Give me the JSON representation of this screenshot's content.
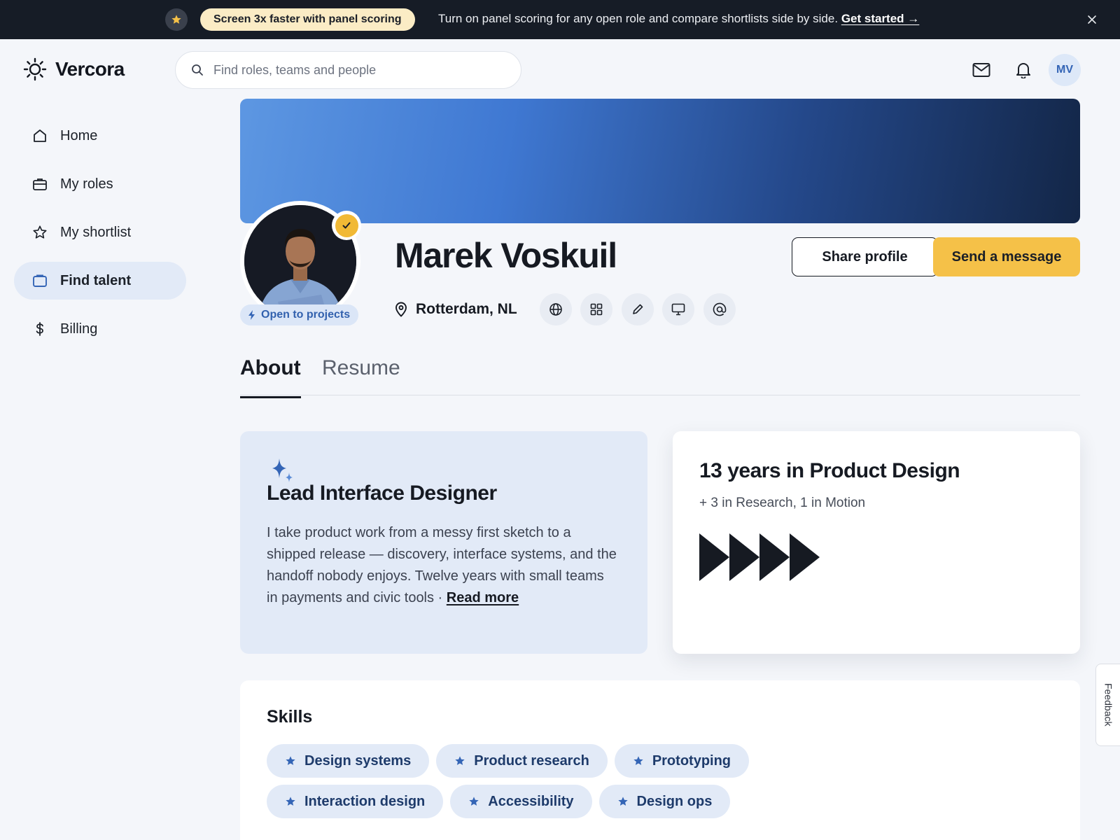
{
  "banner": {
    "pill": "Screen 3x faster with panel scoring",
    "message": "Turn on panel scoring for any open role and compare shortlists side by side.",
    "cta": "Get started →"
  },
  "brand": {
    "name": "Vercora"
  },
  "search": {
    "placeholder": "Find roles, teams and people"
  },
  "user": {
    "initials": "MV"
  },
  "nav": [
    {
      "label": "Home",
      "icon": "home-icon",
      "active": false
    },
    {
      "label": "My roles",
      "icon": "briefcase-icon",
      "active": false
    },
    {
      "label": "My shortlist",
      "icon": "star-icon",
      "active": false
    },
    {
      "label": "Find talent",
      "icon": "folder-icon",
      "active": true
    },
    {
      "label": "Billing",
      "icon": "dollar-icon",
      "active": false
    }
  ],
  "profile": {
    "name": "Marek Voskuil",
    "status": "Open to projects",
    "location": "Rotterdam, NL",
    "links": [
      "globe-icon",
      "grid-icon",
      "pencil-icon",
      "monitor-icon",
      "at-icon"
    ],
    "share_label": "Share profile",
    "message_label": "Send a message"
  },
  "tabs": [
    {
      "label": "About",
      "active": true
    },
    {
      "label": "Resume",
      "active": false
    }
  ],
  "about": {
    "title": "Lead Interface Designer",
    "body": "I take product work from a messy first sketch to a shipped release — discovery, interface systems, and the handoff nobody enjoys. Twelve years with small teams in payments and civic tools ·",
    "read_more": "Read more"
  },
  "experience": {
    "title": "13 years in Product Design",
    "subtitle": "+ 3 in Research, 1 in Motion"
  },
  "skills": {
    "title": "Skills",
    "items": [
      "Design systems",
      "Product research",
      "Prototyping",
      "Interaction design",
      "Accessibility",
      "Design ops"
    ]
  },
  "feedback": {
    "label": "Feedback"
  },
  "colors": {
    "accent": "#f5c148",
    "primary_blue": "#3465b6",
    "chip_bg": "#e2eaf7",
    "banner_bg": "#161c26"
  }
}
